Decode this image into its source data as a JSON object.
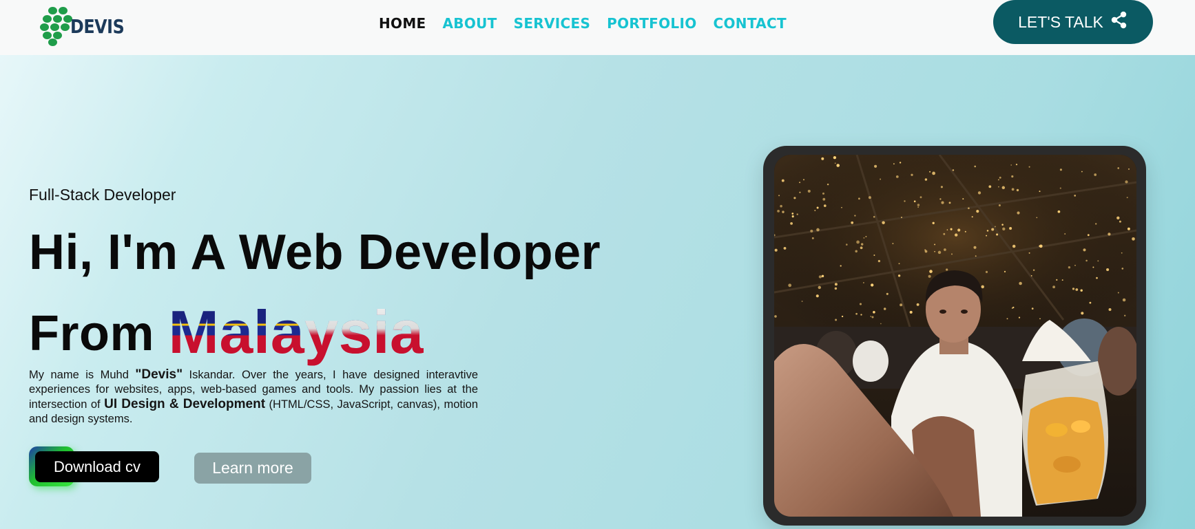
{
  "nav": {
    "brand": "DEVIS",
    "links": [
      "HOME",
      "ABOUT",
      "SERVICES",
      "PORTFOLIO",
      "CONTACT"
    ],
    "active": "HOME",
    "cta_label": "LET'S TALK",
    "cta_icon": "share-icon",
    "colors": {
      "link": "#17c3d1",
      "active": "#111111",
      "cta_bg": "#0b5a63",
      "logo_dots": "#1f9d4a",
      "logo_text": "#1c3a5a"
    }
  },
  "hero": {
    "subtitle": "Full-Stack Developer",
    "headline_line1": "Hi, I'm A Web Developer",
    "headline_line2_prefix": "From",
    "headline_line2_highlight_a": "Mala",
    "headline_line2_highlight_b": "ysia",
    "bio": {
      "p1": "My name is Muhd ",
      "nickname": "\"Devis\"",
      "p2": " Iskandar. Over the years, I have designed interavtive experiences for websites, apps, web-based games and tools. My passion lies at the intersection of ",
      "focus": "UI Design & Development",
      "p3": " (HTML/CSS, JavaScript, canvas), motion and design systems."
    },
    "download_label": "Download cv",
    "learn_label": "Learn more"
  },
  "photo": {
    "icon": "profile-photo"
  }
}
